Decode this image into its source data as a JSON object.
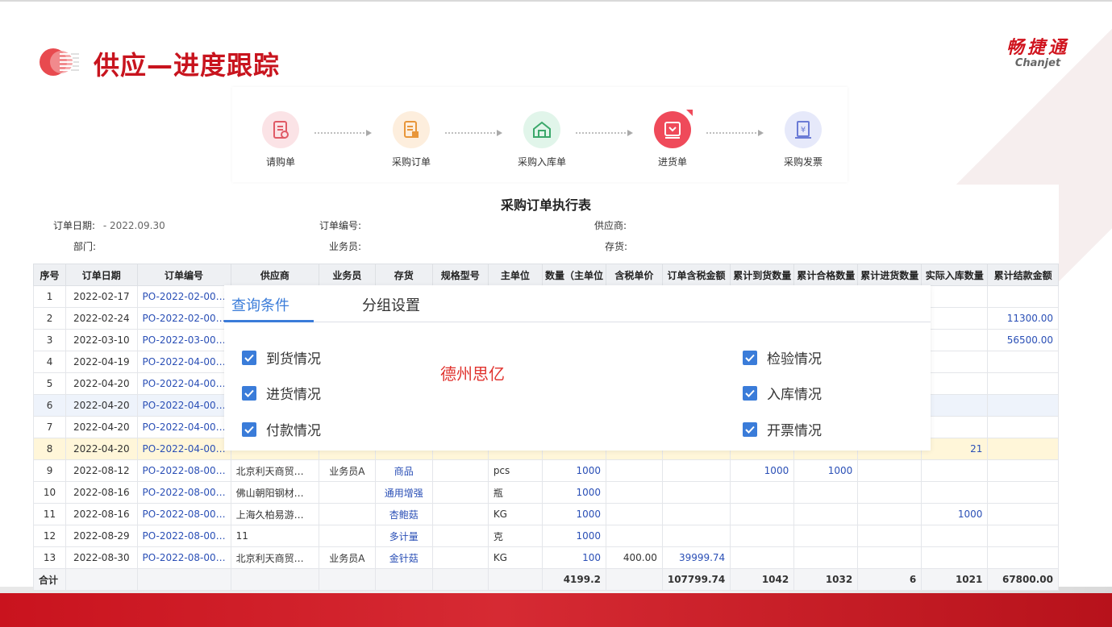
{
  "page": {
    "title": "供应—进度跟踪"
  },
  "brand": {
    "cn": "畅捷通",
    "en": "Chanjet"
  },
  "flow": {
    "steps": [
      {
        "label": "请购单",
        "icon": "requisition-icon"
      },
      {
        "label": "采购订单",
        "icon": "purchase-order-icon"
      },
      {
        "label": "采购入库单",
        "icon": "warehouse-in-icon"
      },
      {
        "label": "进货单",
        "icon": "receiving-icon"
      },
      {
        "label": "采购发票",
        "icon": "invoice-icon"
      }
    ],
    "colors": {
      "pink": "#fbe3e6",
      "orange": "#fdeedd",
      "green": "#e1f5ea",
      "red": "#ef4a5a",
      "lavender": "#e6e9fa"
    }
  },
  "report": {
    "title": "采购订单执行表",
    "fields": {
      "order_date_label": "订单日期:",
      "order_date_value": "- 2022.09.30",
      "order_no_label": "订单编号:",
      "supplier_label": "供应商:",
      "dept_label": "部门:",
      "salesman_label": "业务员:",
      "stock_label": "存货:"
    },
    "columns": [
      "序号",
      "订单日期",
      "订单编号",
      "供应商",
      "业务员",
      "存货",
      "规格型号",
      "主单位",
      "数量（主单位",
      "含税单价",
      "订单含税金额",
      "累计到货数量",
      "累计合格数量",
      "累计进货数量",
      "实际入库数量",
      "累计结款金额"
    ],
    "rows": [
      {
        "no": "1",
        "date": "2022-02-17",
        "order": "PO-2022-02-00…",
        "supplier": "",
        "salesman": "",
        "stock": "",
        "spec": "",
        "unit": "",
        "qty": "",
        "price": "",
        "amount": "",
        "arrived": "",
        "qualified": "",
        "received": "",
        "stored": "",
        "paid": ""
      },
      {
        "no": "2",
        "date": "2022-02-24",
        "order": "PO-2022-02-00…",
        "supplier": "",
        "salesman": "",
        "stock": "",
        "spec": "",
        "unit": "",
        "qty": "",
        "price": "",
        "amount": "",
        "arrived": "",
        "qualified": "",
        "received": "",
        "stored": "",
        "paid": "11300.00"
      },
      {
        "no": "3",
        "date": "2022-03-10",
        "order": "PO-2022-03-00…",
        "supplier": "",
        "salesman": "",
        "stock": "",
        "spec": "",
        "unit": "",
        "qty": "",
        "price": "",
        "amount": "",
        "arrived": "",
        "qualified": "",
        "received": "",
        "stored": "",
        "paid": "56500.00"
      },
      {
        "no": "4",
        "date": "2022-04-19",
        "order": "PO-2022-04-00…",
        "supplier": "",
        "salesman": "",
        "stock": "",
        "spec": "",
        "unit": "",
        "qty": "",
        "price": "",
        "amount": "",
        "arrived": "",
        "qualified": "",
        "received": "",
        "stored": "",
        "paid": ""
      },
      {
        "no": "5",
        "date": "2022-04-20",
        "order": "PO-2022-04-00…",
        "supplier": "",
        "salesman": "",
        "stock": "",
        "spec": "",
        "unit": "",
        "qty": "",
        "price": "",
        "amount": "",
        "arrived": "",
        "qualified": "",
        "received": "",
        "stored": "",
        "paid": ""
      },
      {
        "no": "6",
        "date": "2022-04-20",
        "order": "PO-2022-04-00…",
        "supplier": "",
        "salesman": "",
        "stock": "",
        "spec": "",
        "unit": "",
        "qty": "",
        "price": "",
        "amount": "",
        "arrived": "",
        "qualified": "",
        "received": "",
        "stored": "",
        "paid": ""
      },
      {
        "no": "7",
        "date": "2022-04-20",
        "order": "PO-2022-04-00…",
        "supplier": "",
        "salesman": "",
        "stock": "",
        "spec": "",
        "unit": "",
        "qty": "",
        "price": "",
        "amount": "",
        "arrived": "",
        "qualified": "",
        "received": "",
        "stored": "",
        "paid": ""
      },
      {
        "no": "8",
        "date": "2022-04-20",
        "order": "PO-2022-04-00…",
        "supplier": "",
        "salesman": "",
        "stock": "",
        "spec": "",
        "unit": "",
        "qty": "",
        "price": "",
        "amount": "",
        "arrived": "",
        "qualified": "",
        "received": "",
        "stored": "21",
        "paid": ""
      },
      {
        "no": "9",
        "date": "2022-08-12",
        "order": "PO-2022-08-00…",
        "supplier": "北京利天商贸…",
        "salesman": "业务员A",
        "stock": "商品",
        "spec": "",
        "unit": "pcs",
        "qty": "1000",
        "price": "",
        "amount": "",
        "arrived": "1000",
        "qualified": "1000",
        "received": "",
        "stored": "",
        "paid": ""
      },
      {
        "no": "10",
        "date": "2022-08-16",
        "order": "PO-2022-08-00…",
        "supplier": "佛山朝阳钢材…",
        "salesman": "",
        "stock": "通用增强",
        "spec": "",
        "unit": "瓶",
        "qty": "1000",
        "price": "",
        "amount": "",
        "arrived": "",
        "qualified": "",
        "received": "",
        "stored": "",
        "paid": ""
      },
      {
        "no": "11",
        "date": "2022-08-16",
        "order": "PO-2022-08-00…",
        "supplier": "上海久柏易游…",
        "salesman": "",
        "stock": "杏鲍菇",
        "spec": "",
        "unit": "KG",
        "qty": "1000",
        "price": "",
        "amount": "",
        "arrived": "",
        "qualified": "",
        "received": "",
        "stored": "1000",
        "paid": ""
      },
      {
        "no": "12",
        "date": "2022-08-29",
        "order": "PO-2022-08-00…",
        "supplier": "11",
        "salesman": "",
        "stock": "多计量",
        "spec": "",
        "unit": "克",
        "qty": "1000",
        "price": "",
        "amount": "",
        "arrived": "",
        "qualified": "",
        "received": "",
        "stored": "",
        "paid": ""
      },
      {
        "no": "13",
        "date": "2022-08-30",
        "order": "PO-2022-08-00…",
        "supplier": "北京利天商贸…",
        "salesman": "业务员A",
        "stock": "金针菇",
        "spec": "",
        "unit": "KG",
        "qty": "100",
        "price": "400.00",
        "amount": "39999.74",
        "arrived": "",
        "qualified": "",
        "received": "",
        "stored": "",
        "paid": ""
      }
    ],
    "total": {
      "label": "合计",
      "qty": "4199.2",
      "amount": "107799.74",
      "arrived": "1042",
      "qualified": "1032",
      "received": "6",
      "stored": "1021",
      "paid": "67800.00"
    }
  },
  "overlay": {
    "tabs": [
      "查询条件",
      "分组设置"
    ],
    "checks_left": [
      "到货情况",
      "进货情况",
      "付款情况"
    ],
    "checks_right": [
      "检验情况",
      "入库情况",
      "开票情况"
    ],
    "watermark": "德州思亿"
  },
  "theme": {
    "accent": "#c8141e",
    "link": "#2a4fb6",
    "check": "#3a7cd9"
  }
}
